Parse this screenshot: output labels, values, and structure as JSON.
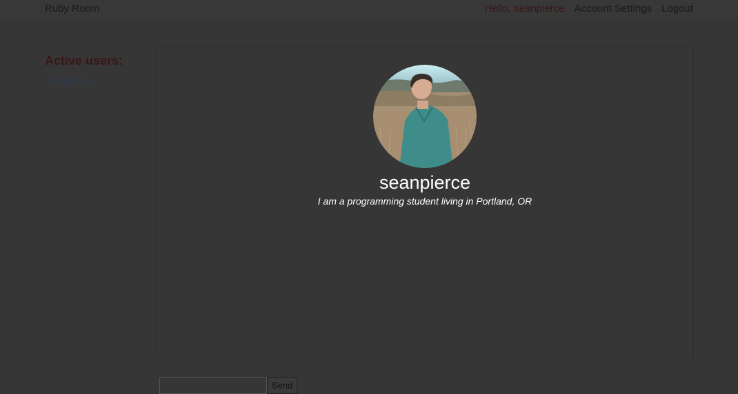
{
  "header": {
    "brand": "Ruby Room",
    "greeting": "Hello, seanpierce",
    "account_settings": "Account Settings",
    "logout": "Logout"
  },
  "sidebar": {
    "title": "Active users:",
    "users": [
      {
        "name": "seanpierce"
      }
    ]
  },
  "profile": {
    "username": "seanpierce",
    "bio": "I am a programming student living in Portland, OR",
    "avatar_icon": "user-photo"
  },
  "composer": {
    "input_value": "",
    "send_label": "Send"
  },
  "colors": {
    "background": "#363636",
    "brand_text": "#1a1a1a",
    "greeting_text": "#3c1414",
    "sidebar_title": "#3a1616",
    "user_link": "#2b3a4f",
    "profile_text": "#ffffff"
  }
}
